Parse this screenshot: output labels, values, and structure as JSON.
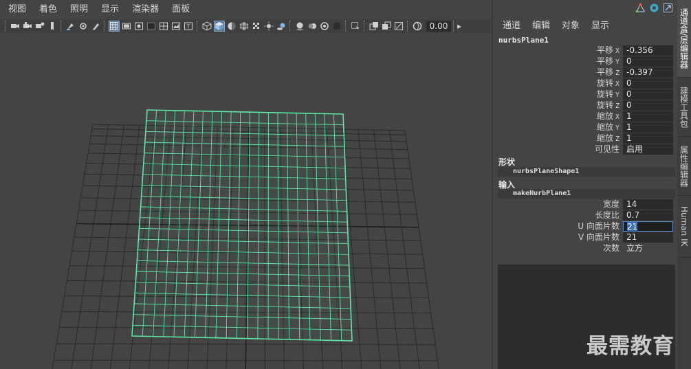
{
  "viewport": {
    "menu": [
      "视图",
      "着色",
      "照明",
      "显示",
      "渲染器",
      "面板"
    ],
    "toolbar": {
      "icons": [
        "camera-icon",
        "camera-attr-icon",
        "bookmark-icon",
        "image-plane-icon",
        "grid-icon",
        "film-gate-icon",
        "resolution-gate-icon",
        "gate-mask-icon",
        "field-chart-icon",
        "safe-action-icon",
        "safe-title-icon",
        "wireframe-icon",
        "smooth-shade-icon",
        "default-material-icon",
        "textured-icon",
        "lights-icon",
        "shadows-icon",
        "ambient-occlusion-icon",
        "motion-blur-icon",
        "anti-alias-icon",
        "depth-of-field-icon",
        "isolate-select-icon",
        "xray-icon",
        "xray-joints-icon",
        "backface-icon",
        "exposure-icon"
      ],
      "exposure_value": "0.00",
      "gamma_label": "▸"
    }
  },
  "channel_box": {
    "menu": [
      "通道",
      "编辑",
      "对象",
      "显示"
    ],
    "object_name": "nurbsPlane1",
    "transform_attrs": [
      {
        "label": "平移",
        "axis": "X",
        "value": "-0.356"
      },
      {
        "label": "平移",
        "axis": "Y",
        "value": "0"
      },
      {
        "label": "平移",
        "axis": "Z",
        "value": "-0.397"
      },
      {
        "label": "旋转",
        "axis": "X",
        "value": "0"
      },
      {
        "label": "旋转",
        "axis": "Y",
        "value": "0"
      },
      {
        "label": "旋转",
        "axis": "Z",
        "value": "0"
      },
      {
        "label": "缩放",
        "axis": "X",
        "value": "1"
      },
      {
        "label": "缩放",
        "axis": "Y",
        "value": "1"
      },
      {
        "label": "缩放",
        "axis": "Z",
        "value": "1"
      },
      {
        "label": "可见性",
        "axis": "",
        "value": "启用"
      }
    ],
    "shape_section": "形状",
    "shape_node": "nurbsPlaneShape1",
    "input_section": "输入",
    "input_node": "makeNurbPlane1",
    "input_attrs": [
      {
        "label": "宽度",
        "value": "14"
      },
      {
        "label": "长度比",
        "value": "0.7"
      },
      {
        "label": "U 向面片数",
        "value": "21"
      },
      {
        "label": "V 向面片数",
        "value": "21"
      },
      {
        "label": "次数",
        "value": "立方"
      }
    ]
  },
  "side_tabs": [
    "通道盒/层编辑器",
    "建模工具包",
    "属性编辑器",
    "Human IK"
  ],
  "watermark": "最需教育",
  "colors": {
    "selected_wire": "#5ee6a8",
    "grid_line": "#2a2a2a",
    "grid_axis": "#1e1e1e",
    "selection_blue": "#3d6fb6"
  }
}
